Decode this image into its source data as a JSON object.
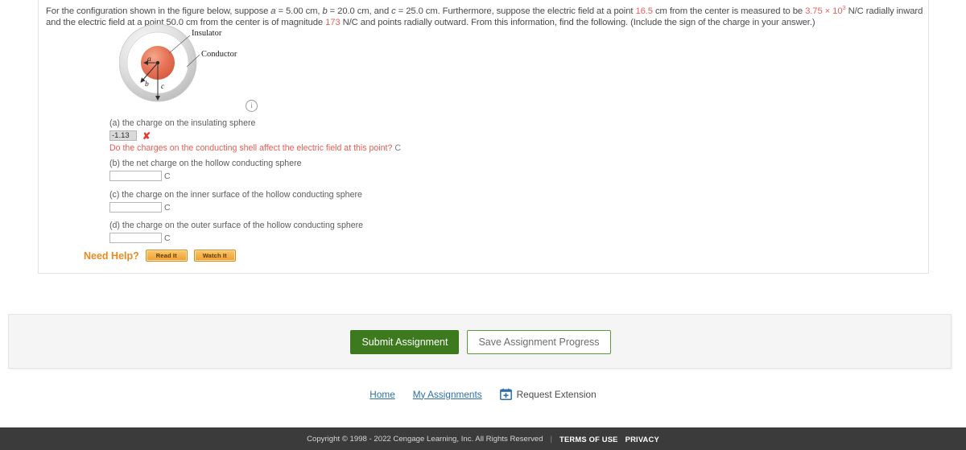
{
  "problem": {
    "segment_1": "For the configuration shown in the figure below, suppose ",
    "var_a": "a",
    "segment_2": " = 5.00 cm, ",
    "var_b": "b",
    "segment_3": " = 20.0 cm, and ",
    "var_c": "c",
    "segment_4": " = 25.0 cm. Furthermore, suppose the electric field at a point ",
    "value_radius_1": "16.5",
    "segment_5": " cm from the center is measured to be ",
    "value_field_1": "3.75",
    "times": " × 10",
    "exponent": "3",
    "segment_6": " N/C radially inward and the electric field at a point 50.0 cm from the center is of magnitude ",
    "value_field_2": "173",
    "segment_7": " N/C and points radially outward. From this information, find the following. (Include the sign of the charge in your answer.)"
  },
  "figure": {
    "label_insulator": "Insulator",
    "label_conductor": "Conductor",
    "label_a": "a",
    "label_b": "b",
    "label_c": "c",
    "info_glyph": "i",
    "colors": {
      "insulator": "#e4694a",
      "conductor": "#d8d8d8"
    }
  },
  "parts": [
    {
      "id": "a",
      "label": "(a) the charge on the insulating sphere",
      "value": "-1.13",
      "unit": "",
      "status": "incorrect",
      "x_glyph": "✘",
      "feedback": "Do the charges on the conducting shell affect the electric field at this point?",
      "feedback_unit": "C"
    },
    {
      "id": "b",
      "label": "(b) the net charge on the hollow conducting sphere",
      "value": "",
      "unit": "C",
      "status": "empty"
    },
    {
      "id": "c",
      "label": "(c) the charge on the inner surface of the hollow conducting sphere",
      "value": "",
      "unit": "C",
      "status": "empty"
    },
    {
      "id": "d",
      "label": "(d) the charge on the outer surface of the hollow conducting sphere",
      "value": "",
      "unit": "C",
      "status": "empty"
    }
  ],
  "need_help": {
    "label": "Need Help?",
    "read_button": "Read It",
    "watch_button": "Watch It"
  },
  "submit": {
    "submit_label": "Submit Assignment",
    "save_label": "Save Assignment Progress",
    "submit_color": "#3d7a1e"
  },
  "footer_nav": {
    "home": "Home",
    "my_assignments": "My Assignments",
    "request_extension": "Request Extension",
    "calendar_icon": "calendar-plus-icon"
  },
  "bottom_bar": {
    "copyright": "Copyright © 1998 - 2022 Cengage Learning, Inc. All Rights Reserved",
    "separator": "|",
    "terms": "TERMS OF USE",
    "privacy": "PRIVACY"
  }
}
